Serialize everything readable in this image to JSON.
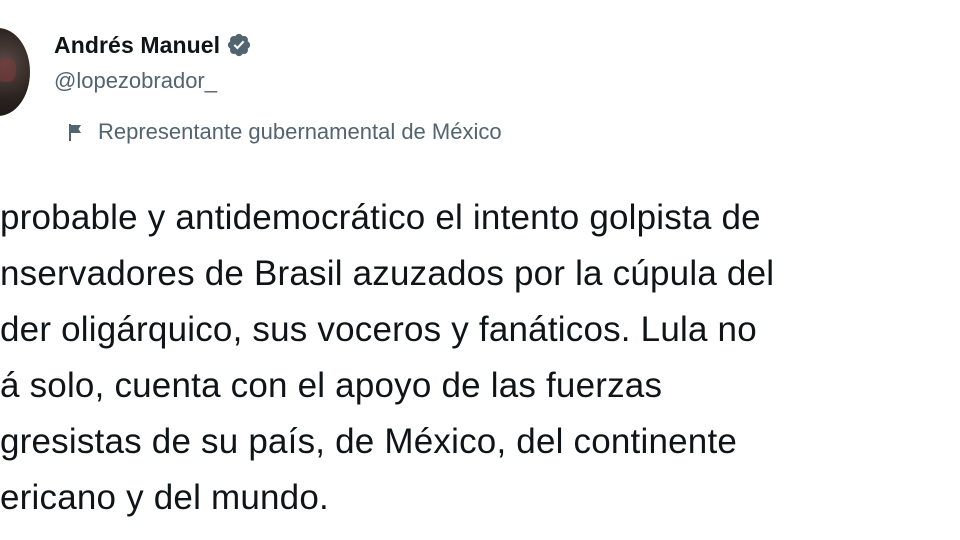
{
  "author": {
    "name": "Andrés Manuel",
    "handle": "@lopezobrador_",
    "label": "Representante gubernamental de México",
    "verified_color": "#1d9bf0"
  },
  "icons": {
    "verified": "verified-badge-icon",
    "label": "flag-icon"
  },
  "tweet": {
    "lines": [
      "probable y antidemocrático el intento golpista de",
      "nservadores de Brasil azuzados por la cúpula del",
      "der oligárquico, sus voceros y fanáticos. Lula no",
      "á solo, cuenta con el apoyo de las fuerzas",
      "gresistas de su país, de México, del continente",
      "ericano y del mundo."
    ]
  }
}
